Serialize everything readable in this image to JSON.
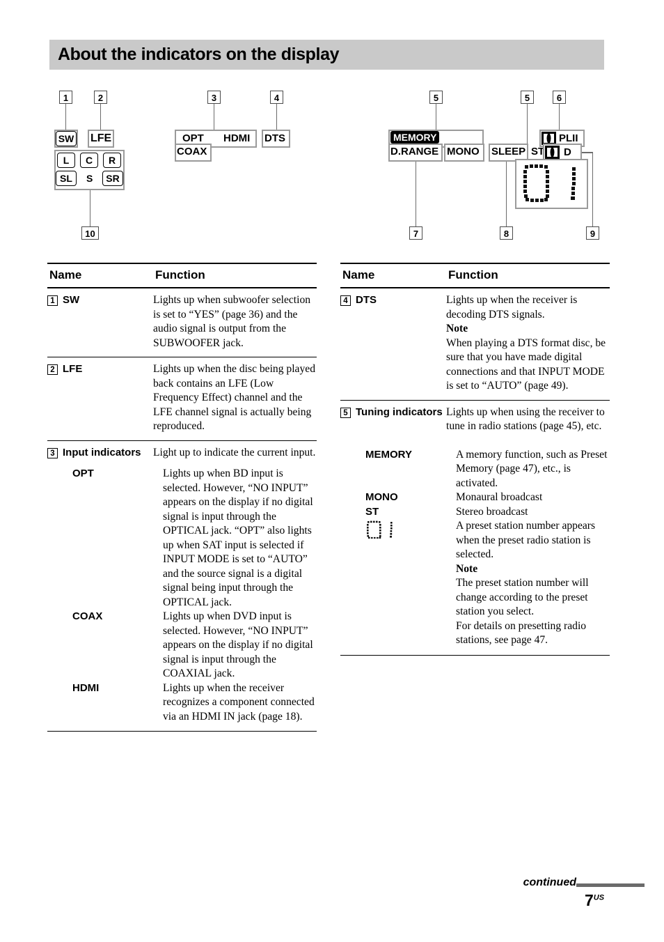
{
  "page": {
    "heading": "About the indicators on the display",
    "footer_continued": "continued",
    "footer_page_number": "7",
    "footer_page_suffix": "US"
  },
  "diagram_left": {
    "callouts": [
      {
        "id": "c1",
        "label": "1"
      },
      {
        "id": "c2",
        "label": "2"
      },
      {
        "id": "c3",
        "label": "3"
      },
      {
        "id": "c4",
        "label": "4"
      },
      {
        "id": "c10",
        "label": "10"
      }
    ],
    "indicators": {
      "sw": "SW",
      "lfe": "LFE",
      "l": "L",
      "c": "C",
      "r": "R",
      "sl": "SL",
      "s": "S",
      "sr": "SR",
      "opt": "OPT",
      "coax": "COAX",
      "hdmi": "HDMI",
      "dts": "DTS"
    }
  },
  "diagram_right": {
    "callouts": [
      {
        "id": "c5a",
        "label": "5"
      },
      {
        "id": "c5b",
        "label": "5"
      },
      {
        "id": "c6",
        "label": "6"
      },
      {
        "id": "c7",
        "label": "7"
      },
      {
        "id": "c8",
        "label": "8"
      },
      {
        "id": "c9",
        "label": "9"
      }
    ],
    "indicators": {
      "memory": "MEMORY",
      "d_range": "D.RANGE",
      "mono": "MONO",
      "sleep": "SLEEP",
      "st": "ST",
      "plii": "PLII",
      "dolby_d": "D",
      "preset_number": "01"
    }
  },
  "table_left": {
    "header": {
      "name": "Name",
      "function": "Function"
    },
    "rows": [
      {
        "num": "1",
        "name": "SW",
        "function": "Lights up when subwoofer selection is set to “YES” (page 36) and the audio signal is output from the SUBWOOFER jack."
      },
      {
        "num": "2",
        "name": "LFE",
        "function": "Lights up when the disc being played back contains an LFE (Low Frequency Effect) channel and the LFE channel signal is actually being reproduced."
      },
      {
        "num": "3",
        "name": "Input indicators",
        "function": "Light up to indicate the current input.",
        "sub": [
          {
            "name": "OPT",
            "function": "Lights up when BD input is selected. However, “NO INPUT” appears on the display if no digital signal is input through the OPTICAL jack. “OPT” also lights up when SAT input is selected if INPUT MODE is set to “AUTO” and the source signal is a digital signal being input through the OPTICAL jack."
          },
          {
            "name": "COAX",
            "function": "Lights up when DVD input is selected. However, “NO INPUT” appears on the display if no digital signal is input through the COAXIAL jack."
          },
          {
            "name": "HDMI",
            "function": "Lights up when the receiver recognizes a component connected via an HDMI IN jack (page 18)."
          }
        ]
      }
    ]
  },
  "table_right": {
    "header": {
      "name": "Name",
      "function": "Function"
    },
    "rows": [
      {
        "num": "4",
        "name": "DTS",
        "function_line1": "Lights up when the receiver is decoding DTS signals.",
        "note_label": "Note",
        "function_line2": "When playing a DTS format disc, be sure that you have made digital connections and that INPUT MODE is set to “AUTO” (page 49)."
      },
      {
        "num": "5",
        "name": "Tuning indicators",
        "function": "Lights up when using the receiver to tune in radio stations (page 45), etc.",
        "sub": [
          {
            "name": "MEMORY",
            "function": "A memory function, such as Preset Memory (page 47), etc., is activated."
          },
          {
            "name": "MONO",
            "function": "Monaural broadcast"
          },
          {
            "name": "ST",
            "function": "Stereo broadcast"
          },
          {
            "name": "preset-digits-icon",
            "function": "A preset station number appears when the preset radio station is selected.",
            "note_label": "Note",
            "note_text": "The preset station number will change according to the preset station you select.",
            "extra_text": "For details on presetting radio stations, see page 47."
          }
        ]
      }
    ]
  }
}
